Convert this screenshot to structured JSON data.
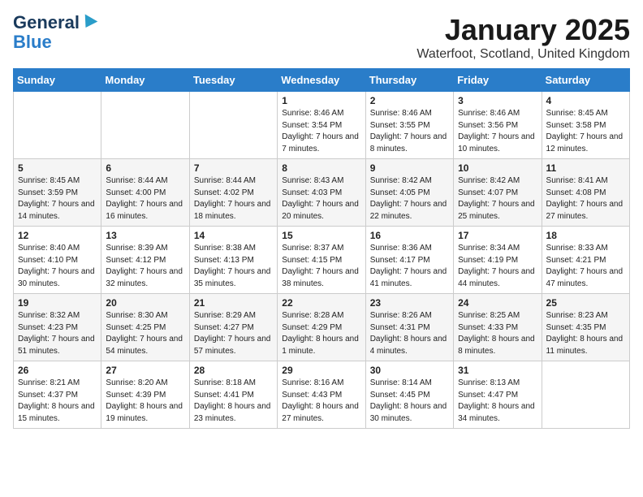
{
  "logo": {
    "line1": "General",
    "line2": "Blue"
  },
  "title": "January 2025",
  "location": "Waterfoot, Scotland, United Kingdom",
  "days_of_week": [
    "Sunday",
    "Monday",
    "Tuesday",
    "Wednesday",
    "Thursday",
    "Friday",
    "Saturday"
  ],
  "weeks": [
    [
      {
        "day": "",
        "sunrise": "",
        "sunset": "",
        "daylight": ""
      },
      {
        "day": "",
        "sunrise": "",
        "sunset": "",
        "daylight": ""
      },
      {
        "day": "",
        "sunrise": "",
        "sunset": "",
        "daylight": ""
      },
      {
        "day": "1",
        "sunrise": "Sunrise: 8:46 AM",
        "sunset": "Sunset: 3:54 PM",
        "daylight": "Daylight: 7 hours and 7 minutes."
      },
      {
        "day": "2",
        "sunrise": "Sunrise: 8:46 AM",
        "sunset": "Sunset: 3:55 PM",
        "daylight": "Daylight: 7 hours and 8 minutes."
      },
      {
        "day": "3",
        "sunrise": "Sunrise: 8:46 AM",
        "sunset": "Sunset: 3:56 PM",
        "daylight": "Daylight: 7 hours and 10 minutes."
      },
      {
        "day": "4",
        "sunrise": "Sunrise: 8:45 AM",
        "sunset": "Sunset: 3:58 PM",
        "daylight": "Daylight: 7 hours and 12 minutes."
      }
    ],
    [
      {
        "day": "5",
        "sunrise": "Sunrise: 8:45 AM",
        "sunset": "Sunset: 3:59 PM",
        "daylight": "Daylight: 7 hours and 14 minutes."
      },
      {
        "day": "6",
        "sunrise": "Sunrise: 8:44 AM",
        "sunset": "Sunset: 4:00 PM",
        "daylight": "Daylight: 7 hours and 16 minutes."
      },
      {
        "day": "7",
        "sunrise": "Sunrise: 8:44 AM",
        "sunset": "Sunset: 4:02 PM",
        "daylight": "Daylight: 7 hours and 18 minutes."
      },
      {
        "day": "8",
        "sunrise": "Sunrise: 8:43 AM",
        "sunset": "Sunset: 4:03 PM",
        "daylight": "Daylight: 7 hours and 20 minutes."
      },
      {
        "day": "9",
        "sunrise": "Sunrise: 8:42 AM",
        "sunset": "Sunset: 4:05 PM",
        "daylight": "Daylight: 7 hours and 22 minutes."
      },
      {
        "day": "10",
        "sunrise": "Sunrise: 8:42 AM",
        "sunset": "Sunset: 4:07 PM",
        "daylight": "Daylight: 7 hours and 25 minutes."
      },
      {
        "day": "11",
        "sunrise": "Sunrise: 8:41 AM",
        "sunset": "Sunset: 4:08 PM",
        "daylight": "Daylight: 7 hours and 27 minutes."
      }
    ],
    [
      {
        "day": "12",
        "sunrise": "Sunrise: 8:40 AM",
        "sunset": "Sunset: 4:10 PM",
        "daylight": "Daylight: 7 hours and 30 minutes."
      },
      {
        "day": "13",
        "sunrise": "Sunrise: 8:39 AM",
        "sunset": "Sunset: 4:12 PM",
        "daylight": "Daylight: 7 hours and 32 minutes."
      },
      {
        "day": "14",
        "sunrise": "Sunrise: 8:38 AM",
        "sunset": "Sunset: 4:13 PM",
        "daylight": "Daylight: 7 hours and 35 minutes."
      },
      {
        "day": "15",
        "sunrise": "Sunrise: 8:37 AM",
        "sunset": "Sunset: 4:15 PM",
        "daylight": "Daylight: 7 hours and 38 minutes."
      },
      {
        "day": "16",
        "sunrise": "Sunrise: 8:36 AM",
        "sunset": "Sunset: 4:17 PM",
        "daylight": "Daylight: 7 hours and 41 minutes."
      },
      {
        "day": "17",
        "sunrise": "Sunrise: 8:34 AM",
        "sunset": "Sunset: 4:19 PM",
        "daylight": "Daylight: 7 hours and 44 minutes."
      },
      {
        "day": "18",
        "sunrise": "Sunrise: 8:33 AM",
        "sunset": "Sunset: 4:21 PM",
        "daylight": "Daylight: 7 hours and 47 minutes."
      }
    ],
    [
      {
        "day": "19",
        "sunrise": "Sunrise: 8:32 AM",
        "sunset": "Sunset: 4:23 PM",
        "daylight": "Daylight: 7 hours and 51 minutes."
      },
      {
        "day": "20",
        "sunrise": "Sunrise: 8:30 AM",
        "sunset": "Sunset: 4:25 PM",
        "daylight": "Daylight: 7 hours and 54 minutes."
      },
      {
        "day": "21",
        "sunrise": "Sunrise: 8:29 AM",
        "sunset": "Sunset: 4:27 PM",
        "daylight": "Daylight: 7 hours and 57 minutes."
      },
      {
        "day": "22",
        "sunrise": "Sunrise: 8:28 AM",
        "sunset": "Sunset: 4:29 PM",
        "daylight": "Daylight: 8 hours and 1 minute."
      },
      {
        "day": "23",
        "sunrise": "Sunrise: 8:26 AM",
        "sunset": "Sunset: 4:31 PM",
        "daylight": "Daylight: 8 hours and 4 minutes."
      },
      {
        "day": "24",
        "sunrise": "Sunrise: 8:25 AM",
        "sunset": "Sunset: 4:33 PM",
        "daylight": "Daylight: 8 hours and 8 minutes."
      },
      {
        "day": "25",
        "sunrise": "Sunrise: 8:23 AM",
        "sunset": "Sunset: 4:35 PM",
        "daylight": "Daylight: 8 hours and 11 minutes."
      }
    ],
    [
      {
        "day": "26",
        "sunrise": "Sunrise: 8:21 AM",
        "sunset": "Sunset: 4:37 PM",
        "daylight": "Daylight: 8 hours and 15 minutes."
      },
      {
        "day": "27",
        "sunrise": "Sunrise: 8:20 AM",
        "sunset": "Sunset: 4:39 PM",
        "daylight": "Daylight: 8 hours and 19 minutes."
      },
      {
        "day": "28",
        "sunrise": "Sunrise: 8:18 AM",
        "sunset": "Sunset: 4:41 PM",
        "daylight": "Daylight: 8 hours and 23 minutes."
      },
      {
        "day": "29",
        "sunrise": "Sunrise: 8:16 AM",
        "sunset": "Sunset: 4:43 PM",
        "daylight": "Daylight: 8 hours and 27 minutes."
      },
      {
        "day": "30",
        "sunrise": "Sunrise: 8:14 AM",
        "sunset": "Sunset: 4:45 PM",
        "daylight": "Daylight: 8 hours and 30 minutes."
      },
      {
        "day": "31",
        "sunrise": "Sunrise: 8:13 AM",
        "sunset": "Sunset: 4:47 PM",
        "daylight": "Daylight: 8 hours and 34 minutes."
      },
      {
        "day": "",
        "sunrise": "",
        "sunset": "",
        "daylight": ""
      }
    ]
  ]
}
